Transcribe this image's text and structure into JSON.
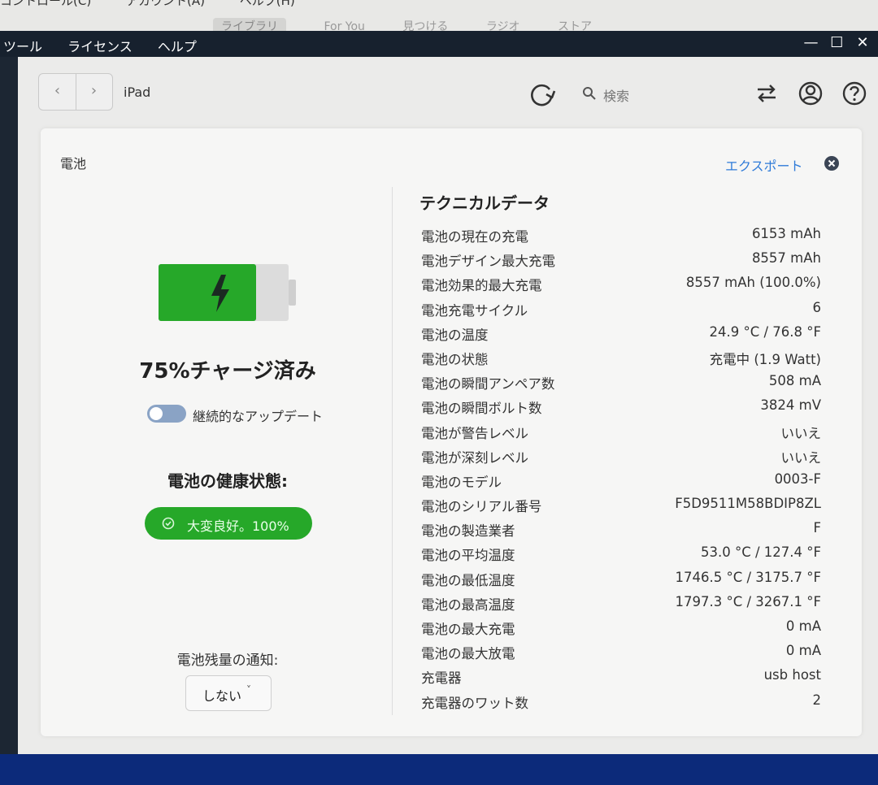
{
  "background_app": {
    "menu": [
      "コントロール(C)",
      "アカウント(A)",
      "ヘルプ(H)"
    ],
    "tabs": [
      "ライブラリ",
      "For You",
      "見つける",
      "ラジオ",
      "ストア"
    ]
  },
  "titlebar": {
    "menu": [
      "ツール",
      "ライセンス",
      "ヘルプ"
    ],
    "minimize": "—",
    "maximize": "☐",
    "close": "✕"
  },
  "toolbar": {
    "back": "‹",
    "forward": "›",
    "device": "iPad",
    "search_placeholder": "検索"
  },
  "panel": {
    "title": "電池",
    "export_label": "エクスポート",
    "charge_text": "75%チャージ済み",
    "charge_level": 0.75,
    "auto_update_label": "継続的なアップデート",
    "health_title": "電池の健康状態:",
    "health_badge": "大変良好。100%",
    "notify_label": "電池残量の通知:",
    "notify_value": "しない"
  },
  "tech": {
    "title": "テクニカルデータ",
    "rows": [
      {
        "k": "電池の現在の充電",
        "v": "6153 mAh"
      },
      {
        "k": "電池デザイン最大充電",
        "v": "8557 mAh"
      },
      {
        "k": "電池効果的最大充電",
        "v": "8557 mAh (100.0%)"
      },
      {
        "k": "電池充電サイクル",
        "v": "6"
      },
      {
        "k": "電池の温度",
        "v": "24.9 °C / 76.8 °F"
      },
      {
        "k": "電池の状態",
        "v": "充電中 (1.9 Watt)"
      },
      {
        "k": "電池の瞬間アンペア数",
        "v": "508 mA"
      },
      {
        "k": "電池の瞬間ボルト数",
        "v": "3824 mV"
      },
      {
        "k": "電池が警告レベル",
        "v": "いいえ"
      },
      {
        "k": "電池が深刻レベル",
        "v": "いいえ"
      },
      {
        "k": "電池のモデル",
        "v": "0003-F"
      },
      {
        "k": "電池のシリアル番号",
        "v": "F5D9511M58BDIP8ZL"
      },
      {
        "k": "電池の製造業者",
        "v": "F"
      },
      {
        "k": "電池の平均温度",
        "v": "53.0 °C / 127.4 °F"
      },
      {
        "k": "電池の最低温度",
        "v": "1746.5 °C / 3175.7 °F"
      },
      {
        "k": "電池の最高温度",
        "v": "1797.3 °C / 3267.1 °F"
      },
      {
        "k": "電池の最大充電",
        "v": "0 mA"
      },
      {
        "k": "電池の最大放電",
        "v": "0 mA"
      },
      {
        "k": "充電器",
        "v": "usb host"
      },
      {
        "k": "充電器のワット数",
        "v": "2"
      }
    ]
  },
  "colors": {
    "accent": "#2f7bd8",
    "battery_green": "#26a829",
    "titlebar": "#17212e"
  }
}
